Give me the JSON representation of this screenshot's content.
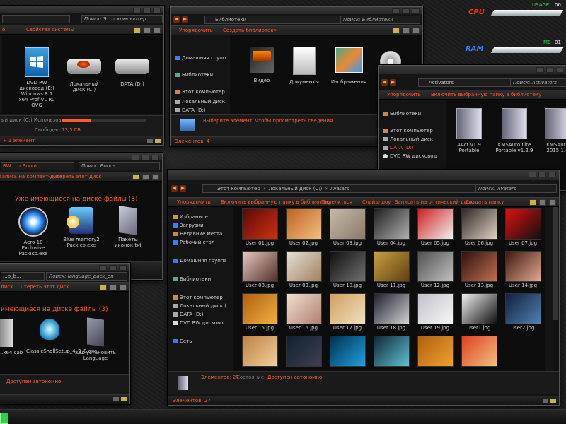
{
  "colors": {
    "accent": "#ff5a2a",
    "nav_button": "#6b2a0c",
    "gadget_cpu": "#ff3010",
    "gadget_ram": "#3a7bff",
    "gadget_usage": "#25d94a"
  },
  "gadget": {
    "cpu_label": "CPU",
    "usage_label": "USAGE",
    "usage_value": "00",
    "ram_label": "RAM",
    "mb_label": "MB",
    "mb_value": "01"
  },
  "w1": {
    "search": "Поиск: Этот компьютер",
    "toolbar": [
      "Свойства системы"
    ],
    "nav_truncated": [
      "о",
      "а"
    ],
    "items": [
      {
        "label": "DVD RW дисковод (E:) Windows 8.1 x64 Prof VL Ru OVG",
        "icon": "windows-dvd-icon"
      },
      {
        "label": "Локальный диск (C:)",
        "icon": "hdd-icon"
      },
      {
        "label": "DATA (D:)",
        "icon": "hdd-icon"
      }
    ],
    "details": [
      "ый диск (C:) Использовано:",
      "Свободно:",
      "73,3 ГБ"
    ],
    "status": "н 1 элемент"
  },
  "w2": {
    "path": "Библиотеки",
    "search": "Поиск: Библиотеки",
    "toolbar": [
      "Упорядочить",
      "Создать библиотеку"
    ],
    "nav": [
      "Домашняя групп",
      "Библиотеки",
      "Этот компьютер",
      "Локальный диск",
      "DATA (D:)"
    ],
    "items": [
      {
        "label": "Видео",
        "icon": "video-library-icon"
      },
      {
        "label": "Документы",
        "icon": "documents-library-icon"
      },
      {
        "label": "Изображения",
        "icon": "pictures-library-icon"
      }
    ],
    "details": "Выберите элемент, чтобы просмотреть сведения",
    "status": "Элементов: 4"
  },
  "w3": {
    "path": "Activators",
    "search": "Поиск: Activators",
    "toolbar": [
      "Упорядочить",
      "Включить выбранную папку в библиотеку"
    ],
    "nav": [
      "Библиотеки",
      "Этот компьютер",
      "Локальный диск",
      "DATA (D:)",
      "DVD RW дисковод"
    ],
    "items": [
      {
        "label": "AAct v1.9 Portable",
        "icon": "folder-icon"
      },
      {
        "label": "KMSAuto Lite Portable v1.2.9",
        "icon": "folder-icon"
      },
      {
        "label": "KMSAuto 2015 1.4",
        "icon": "folder-icon"
      }
    ]
  },
  "w4": {
    "path": "RW ...",
    "path2": "Bonus",
    "search": "Поиск: Bonus",
    "toolbar": [
      "запись на компакт-диск",
      "Стереть этот диск"
    ],
    "heading": "Уже имеющиеся на диске файлы (3)",
    "items": [
      {
        "label": "Aero 10 Exclusive PackIco.exe",
        "icon": "aero-app-icon"
      },
      {
        "label": "Blue memory2 PackIco.exe",
        "icon": "blue-app-icon"
      },
      {
        "label": "Пакеты иконок.txt",
        "icon": "text-file-icon"
      }
    ]
  },
  "w5": {
    "path": "...р_b...",
    "search": "Поиск: language_pack_en",
    "toolbar": [
      "диск",
      "Стереть этот диск"
    ],
    "heading": "имеющиеся на диске файлы (3)",
    "items": [
      {
        "label": "...x64.cab",
        "icon": "cab-file-icon"
      },
      {
        "label": "ClassicShellSetup_4_3_0.exe",
        "icon": "shell-icon"
      },
      {
        "label": "Как установить Language pack.txt",
        "icon": "text-file-icon"
      }
    ],
    "status": "Доступен автономно"
  },
  "w6": {
    "path": [
      "Этот компьютер",
      "Локальный диск (C:)",
      "Avatars"
    ],
    "search": "Поиск: Avatars",
    "toolbar": [
      "Упорядочить",
      "Включить выбранную папку в библиотеку",
      "Поделиться",
      "Слайд-шоу",
      "Записать на оптический диск",
      "Создать папку"
    ],
    "nav": [
      {
        "label": "Избранное",
        "icon": "star-icon"
      },
      {
        "label": "Загрузки",
        "icon": "downloads-icon"
      },
      {
        "label": "Недавние места",
        "icon": "recent-icon"
      },
      {
        "label": "Рабочий стол",
        "icon": "desktop-icon"
      },
      {
        "label": "Домашняя группа",
        "icon": "homegroup-icon"
      },
      {
        "label": "Библиотеки",
        "icon": "libraries-icon"
      },
      {
        "label": "Этот компьютер",
        "icon": "computer-icon"
      },
      {
        "label": "Локальный диск (",
        "icon": "hdd-icon"
      },
      {
        "label": "DATA (D:)",
        "icon": "hdd-icon"
      },
      {
        "label": "DVD RW дисково",
        "icon": "dvd-icon"
      },
      {
        "label": "Сеть",
        "icon": "network-icon"
      }
    ],
    "thumbs": [
      {
        "label": "User 01.jpg",
        "c1": "#5a0a0a",
        "c2": "#d03010"
      },
      {
        "label": "User 02.jpg",
        "c1": "#c06020",
        "c2": "#f0c080"
      },
      {
        "label": "User 03.jpg",
        "c1": "#c8b8a8",
        "c2": "#8a7a6a"
      },
      {
        "label": "User 04.jpg",
        "c1": "#202020",
        "c2": "#b0b0b0"
      },
      {
        "label": "User 05.jpg",
        "c1": "#d02020",
        "c2": "#f0f0f0"
      },
      {
        "label": "User 06.jpg",
        "c1": "#302828",
        "c2": "#e0d0c0"
      },
      {
        "label": "User 07.jpg",
        "c1": "#e01010",
        "c2": "#101010"
      },
      {
        "label": "User 08.jpg",
        "c1": "#e8c8c0",
        "c2": "#503028"
      },
      {
        "label": "User 09.jpg",
        "c1": "#e8e0d8",
        "c2": "#a08060"
      },
      {
        "label": "User 10.jpg",
        "c1": "#101010",
        "c2": "#707070"
      },
      {
        "label": "User 11.jpg",
        "c1": "#c8a040",
        "c2": "#604010"
      },
      {
        "label": "User 12.jpg",
        "c1": "#505050",
        "c2": "#c0c0c0"
      },
      {
        "label": "User 13.jpg",
        "c1": "#301010",
        "c2": "#c07050"
      },
      {
        "label": "User 14.jpg",
        "c1": "#401810",
        "c2": "#e0a890"
      },
      {
        "label": "User 15.jpg",
        "c1": "#b06010",
        "c2": "#f0b040"
      },
      {
        "label": "User 16.jpg",
        "c1": "#f0e0d0",
        "c2": "#b08070"
      },
      {
        "label": "User 17.jpg",
        "c1": "#d0a060",
        "c2": "#f0e0c0"
      },
      {
        "label": "User 18.jpg",
        "c1": "#202030",
        "c2": "#d0d0d0"
      },
      {
        "label": "User 19.jpg",
        "c1": "#c0c0c8",
        "c2": "#f8f8f8"
      },
      {
        "label": "user1.jpg",
        "c1": "#f0f0f0",
        "c2": "#101010"
      },
      {
        "label": "user2.jpg",
        "c1": "#102040",
        "c2": "#5080b0"
      },
      {
        "label": "",
        "c1": "#c08040",
        "c2": "#f0d0a0"
      },
      {
        "label": "",
        "c1": "#102030",
        "c2": "#404050"
      },
      {
        "label": "",
        "c1": "#003050",
        "c2": "#20a0e0"
      },
      {
        "label": "",
        "c1": "#102838",
        "c2": "#60c0d0"
      },
      {
        "label": "",
        "c1": "#b06010",
        "c2": "#f0a030"
      },
      {
        "label": "",
        "c1": "#e04020",
        "c2": "#f0c080"
      }
    ],
    "details_count": "Элементов: 27",
    "details_state": "Состояние:",
    "details_offline": "Доступен автономно",
    "status": "Элементов: 27"
  }
}
